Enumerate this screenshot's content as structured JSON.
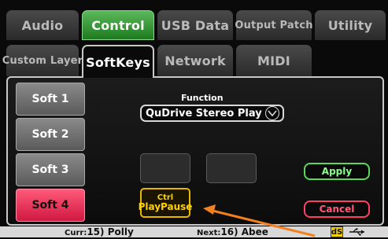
{
  "tabs_row1": [
    {
      "label": "Audio",
      "active": false
    },
    {
      "label": "Control",
      "active": true
    },
    {
      "label": "USB Data",
      "active": false
    },
    {
      "label": "Output Patch",
      "active": false
    },
    {
      "label": "Utility",
      "active": false
    }
  ],
  "tabs_row2": [
    {
      "label": "Custom Layer",
      "active": false
    },
    {
      "label": "SoftKeys",
      "active": true
    },
    {
      "label": "Network",
      "active": false
    },
    {
      "label": "MIDI",
      "active": false
    }
  ],
  "soft_keys": [
    {
      "label": "Soft 1",
      "selected": false
    },
    {
      "label": "Soft 2",
      "selected": false
    },
    {
      "label": "Soft 3",
      "selected": false
    },
    {
      "label": "Soft 4",
      "selected": true
    }
  ],
  "function": {
    "label": "Function",
    "value": "QuDrive Stereo Play"
  },
  "assignment": {
    "line1": "Ctrl",
    "line2": "PlayPause"
  },
  "buttons": {
    "apply": "Apply",
    "cancel": "Cancel"
  },
  "status": {
    "curr_prefix": "Curr:",
    "curr_value": "15) Polly",
    "next_prefix": "Next:",
    "next_value": "16) Abee",
    "ds_logo": "dS"
  },
  "colors": {
    "active_tab": "#2e9a2e",
    "selected_softkey": "#e8284e",
    "assignment": "#e8b800",
    "apply": "#5bd85b",
    "cancel": "#ff4060",
    "arrow": "#f08020"
  }
}
